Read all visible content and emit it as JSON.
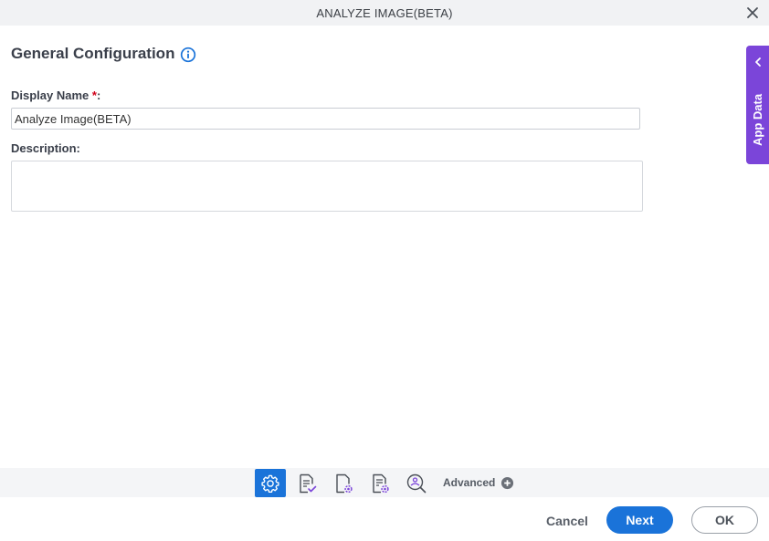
{
  "window": {
    "title": "ANALYZE IMAGE(BETA)",
    "close_icon": "close-icon"
  },
  "form": {
    "section_title": "General Configuration",
    "info_icon": "info-icon",
    "display_name": {
      "label": "Display Name ",
      "required_mark": "*",
      "suffix": ":",
      "value": "Analyze Image(BETA)"
    },
    "description": {
      "label": "Description:",
      "value": ""
    }
  },
  "side_panel": {
    "label": "App Data",
    "icon": "chevron-left-icon",
    "color": "#7b45d9"
  },
  "toolbar": {
    "tools": [
      {
        "icon": "gear-icon",
        "active": true
      },
      {
        "icon": "document-check-icon",
        "active": false
      },
      {
        "icon": "document-gear-icon",
        "active": false
      },
      {
        "icon": "document-list-gear-icon",
        "active": false
      },
      {
        "icon": "image-search-icon",
        "active": false
      }
    ],
    "advanced_label": "Advanced",
    "advanced_icon": "plus-circle-icon",
    "active_color": "#1a73d9"
  },
  "footer": {
    "cancel_label": "Cancel",
    "next_label": "Next",
    "ok_label": "OK",
    "primary_color": "#1a73d9"
  }
}
